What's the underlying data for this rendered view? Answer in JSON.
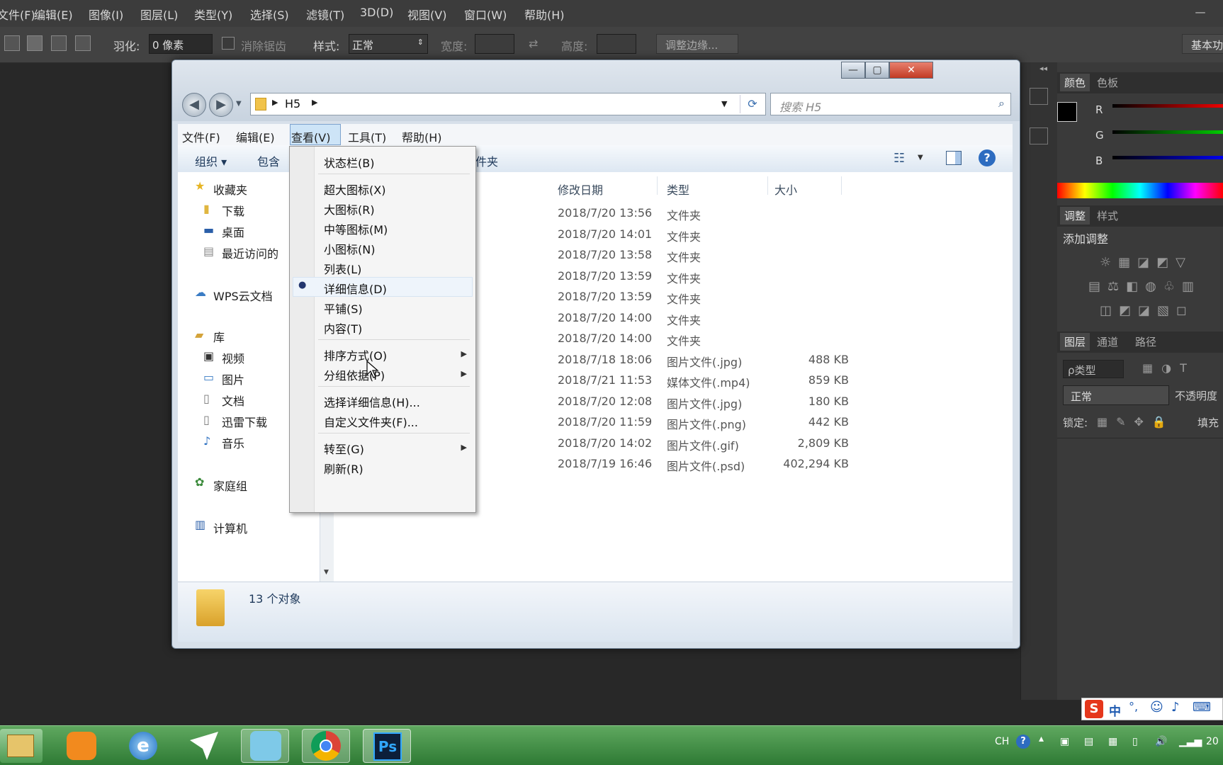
{
  "photoshop": {
    "menu": [
      "文件(F)",
      "编辑(E)",
      "图像(I)",
      "图层(L)",
      "类型(Y)",
      "选择(S)",
      "滤镜(T)",
      "3D(D)",
      "视图(V)",
      "窗口(W)",
      "帮助(H)"
    ],
    "options": {
      "feather_label": "羽化:",
      "feather_value": "0 像素",
      "antialias_label": "消除锯齿",
      "style_label": "样式:",
      "style_value": "正常",
      "width_label": "宽度:",
      "height_label": "高度:",
      "refine_edge_button": "调整边缘...",
      "workspace_button": "基本功"
    },
    "color_panel": {
      "tabs": [
        "颜色",
        "色板"
      ],
      "channels": [
        "R",
        "G",
        "B"
      ]
    },
    "adjustments_panel": {
      "tabs": [
        "调整",
        "样式"
      ],
      "add_label": "添加调整"
    },
    "layers_panel": {
      "tabs": [
        "图层",
        "通道",
        "路径"
      ],
      "kind_filter": "ρ类型",
      "blend_mode": "正常",
      "opacity_label": "不透明度",
      "lock_label": "锁定:",
      "fill_label": "填充"
    }
  },
  "explorer": {
    "breadcrumb": "H5",
    "search_placeholder": "搜索 H5",
    "menu": [
      "文件(F)",
      "编辑(E)",
      "查看(V)",
      "工具(T)",
      "帮助(H)"
    ],
    "toolbar": {
      "organize": "组织",
      "include": "包含",
      "new_folder_tail": "件夹"
    },
    "nav": {
      "favorites": "收藏夹",
      "downloads": "下载",
      "desktop": "桌面",
      "recent": "最近访问的",
      "wps_cloud": "WPS云文档",
      "libraries": "库",
      "videos": "视频",
      "pictures": "图片",
      "documents": "文档",
      "thunder": "迅雷下载",
      "music": "音乐",
      "homegroup": "家庭组",
      "computer": "计算机"
    },
    "columns": {
      "date": "修改日期",
      "type": "类型",
      "size": "大小"
    },
    "rows": [
      {
        "date": "2018/7/20 13:56",
        "type": "文件夹",
        "size": ""
      },
      {
        "date": "2018/7/20 14:01",
        "type": "文件夹",
        "size": ""
      },
      {
        "date": "2018/7/20 13:58",
        "type": "文件夹",
        "size": ""
      },
      {
        "date": "2018/7/20 13:59",
        "type": "文件夹",
        "size": ""
      },
      {
        "date": "2018/7/20 13:59",
        "type": "文件夹",
        "size": ""
      },
      {
        "date": "2018/7/20 14:00",
        "type": "文件夹",
        "size": ""
      },
      {
        "date": "2018/7/20 14:00",
        "type": "文件夹",
        "size": ""
      },
      {
        "date": "2018/7/18 18:06",
        "type": "图片文件(.jpg)",
        "size": "488 KB"
      },
      {
        "date": "2018/7/21 11:53",
        "type": "媒体文件(.mp4)",
        "size": "859 KB"
      },
      {
        "date": "2018/7/20 12:08",
        "type": "图片文件(.jpg)",
        "size": "180 KB"
      },
      {
        "date": "2018/7/20 11:59",
        "type": "图片文件(.png)",
        "size": "442 KB"
      },
      {
        "date": "2018/7/20 14:02",
        "type": "图片文件(.gif)",
        "size": "2,809 KB"
      },
      {
        "date": "2018/7/19 16:46",
        "type": "图片文件(.psd)",
        "size": "402,294 KB"
      }
    ],
    "status": "13 个对象",
    "view_menu": {
      "status_bar": "状态栏(B)",
      "extra_large": "超大图标(X)",
      "large": "大图标(R)",
      "medium": "中等图标(M)",
      "small": "小图标(N)",
      "list": "列表(L)",
      "details": "详细信息(D)",
      "tiles": "平铺(S)",
      "content": "内容(T)",
      "sort_by": "排序方式(O)",
      "group_by": "分组依据(P)",
      "choose_details": "选择详细信息(H)...",
      "customize": "自定义文件夹(F)...",
      "go_to": "转至(G)",
      "refresh": "刷新(R)"
    }
  },
  "taskbar": {
    "ps_label": "Ps",
    "lang": "CH",
    "ime": "中",
    "clock_fragment": "20"
  },
  "colors": {
    "ps_bg": "#282828",
    "taskbar": "#3d8c42",
    "menu_highlight": "#cde4f7"
  }
}
